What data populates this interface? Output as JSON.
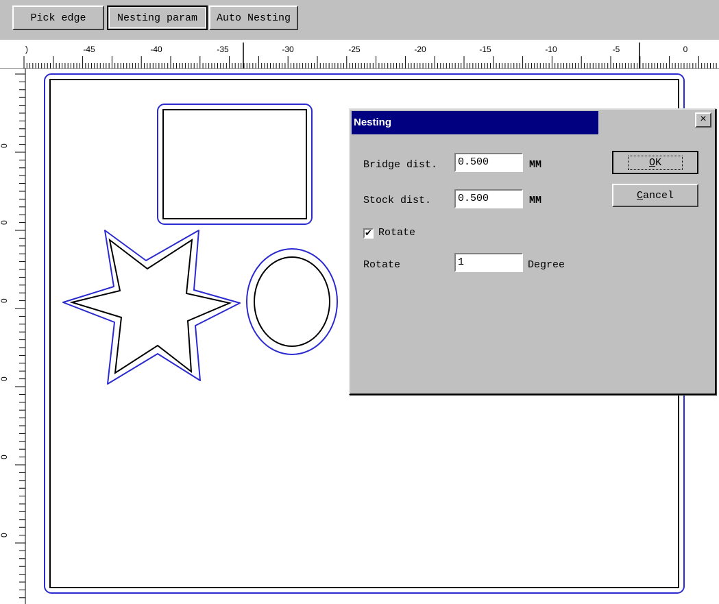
{
  "toolbar": {
    "pick_edge": "Pick edge",
    "nesting_param": "Nesting param",
    "auto_nesting": "Auto Nesting"
  },
  "ruler": {
    "h_labels": [
      "-45",
      "-40",
      "-35",
      "-30",
      "-25",
      "-20",
      "-15",
      "-10",
      "-5",
      "0"
    ],
    "v_labels": [
      "0",
      "0",
      "0",
      "0",
      "0",
      "0"
    ]
  },
  "dialog": {
    "title": "Nesting",
    "close_glyph": "×",
    "bridge_label": "Bridge dist.",
    "bridge_value": "0.500",
    "bridge_unit": "MM",
    "stock_label": "Stock dist.",
    "stock_value": "0.500",
    "stock_unit": "MM",
    "rotate_check_label": "Rotate",
    "rotate_checked": true,
    "rotate_label": "Rotate",
    "rotate_value": "1",
    "rotate_unit": "Degree",
    "ok_first": "O",
    "ok_rest": "K",
    "cancel_first": "C",
    "cancel_rest": "ancel"
  },
  "colors": {
    "outline": "#2a2ad0",
    "part": "#000000",
    "titlebar": "#000080",
    "face": "#c0c0c0"
  }
}
